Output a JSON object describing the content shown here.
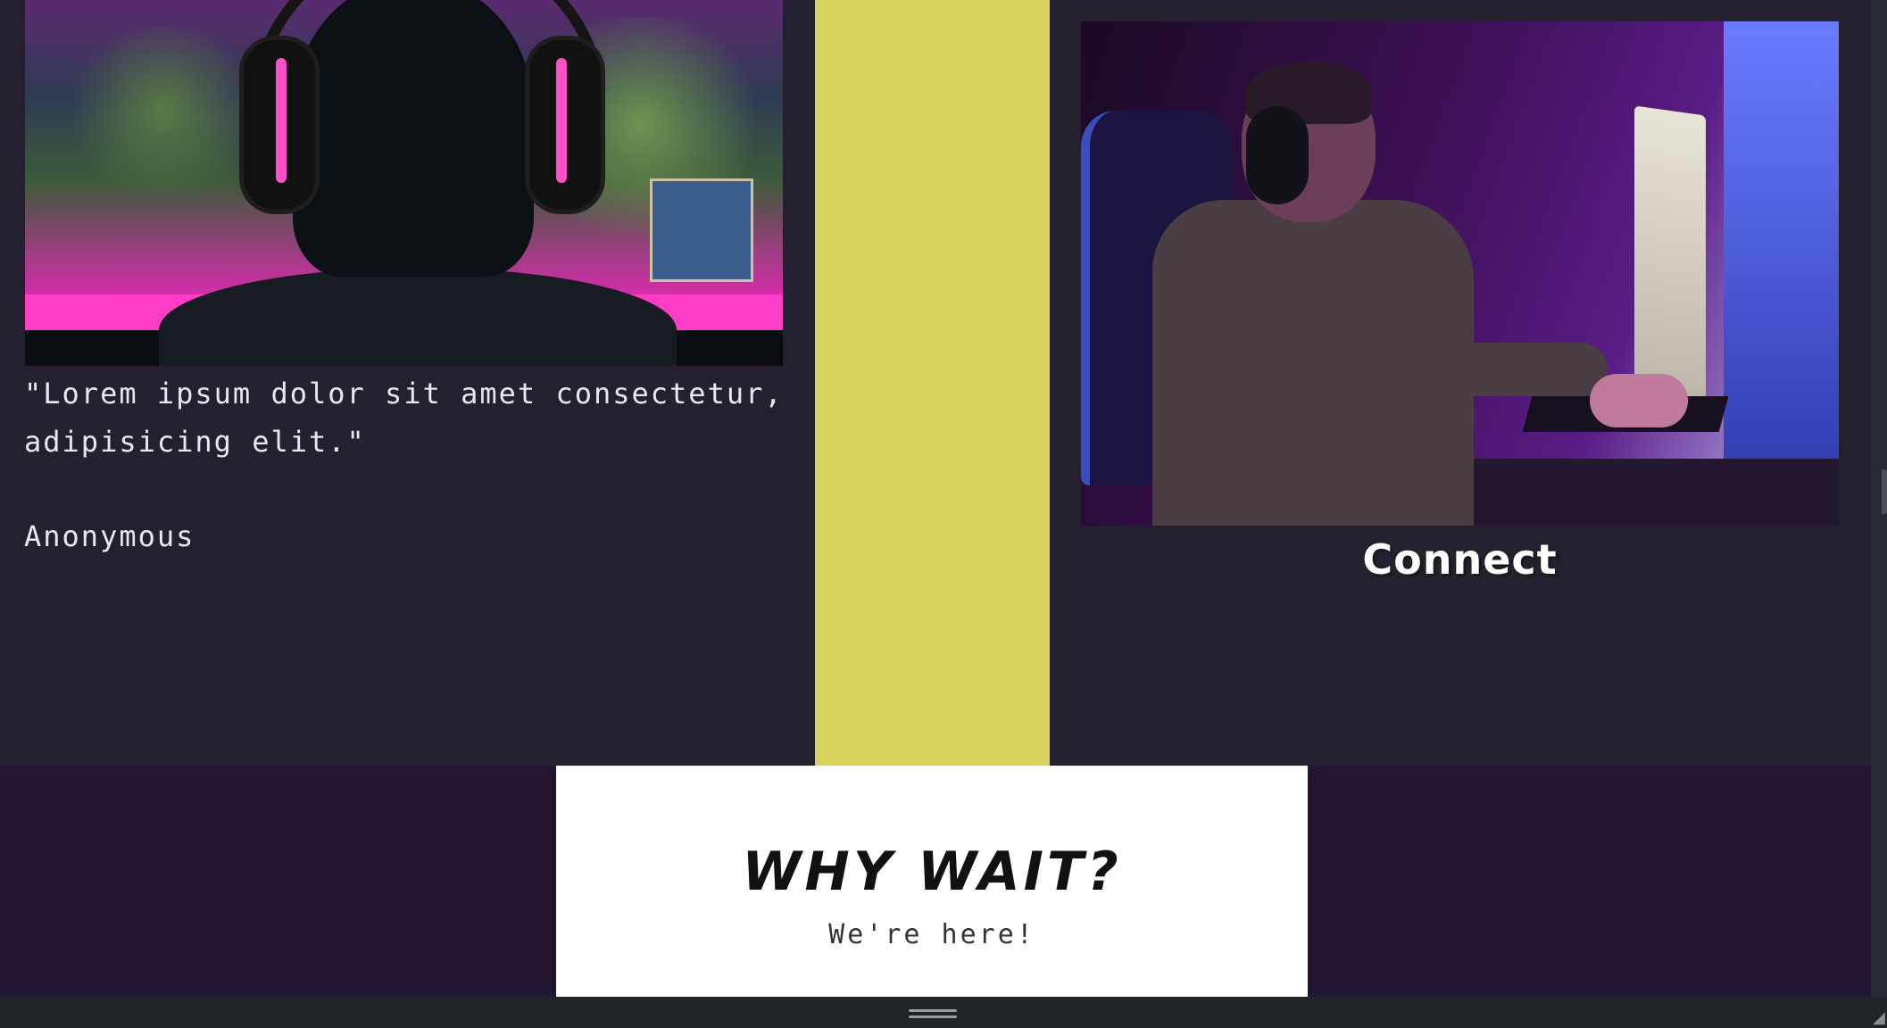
{
  "testimonial": {
    "quote": "\"Lorem ipsum dolor sit amet consectetur, adipisicing elit.\"",
    "author": "Anonymous"
  },
  "feature": {
    "title": "Connect"
  },
  "cta": {
    "title": "WHY WAIT?",
    "subtitle": "We're here!"
  },
  "colors": {
    "page_bg": "#24202f",
    "accent_yellow": "#d6d35e",
    "band_purple": "#231632",
    "card_white": "#ffffff"
  },
  "icons": {
    "resize_handle": "drag-handle-icon",
    "corner": "resize-corner-icon"
  }
}
